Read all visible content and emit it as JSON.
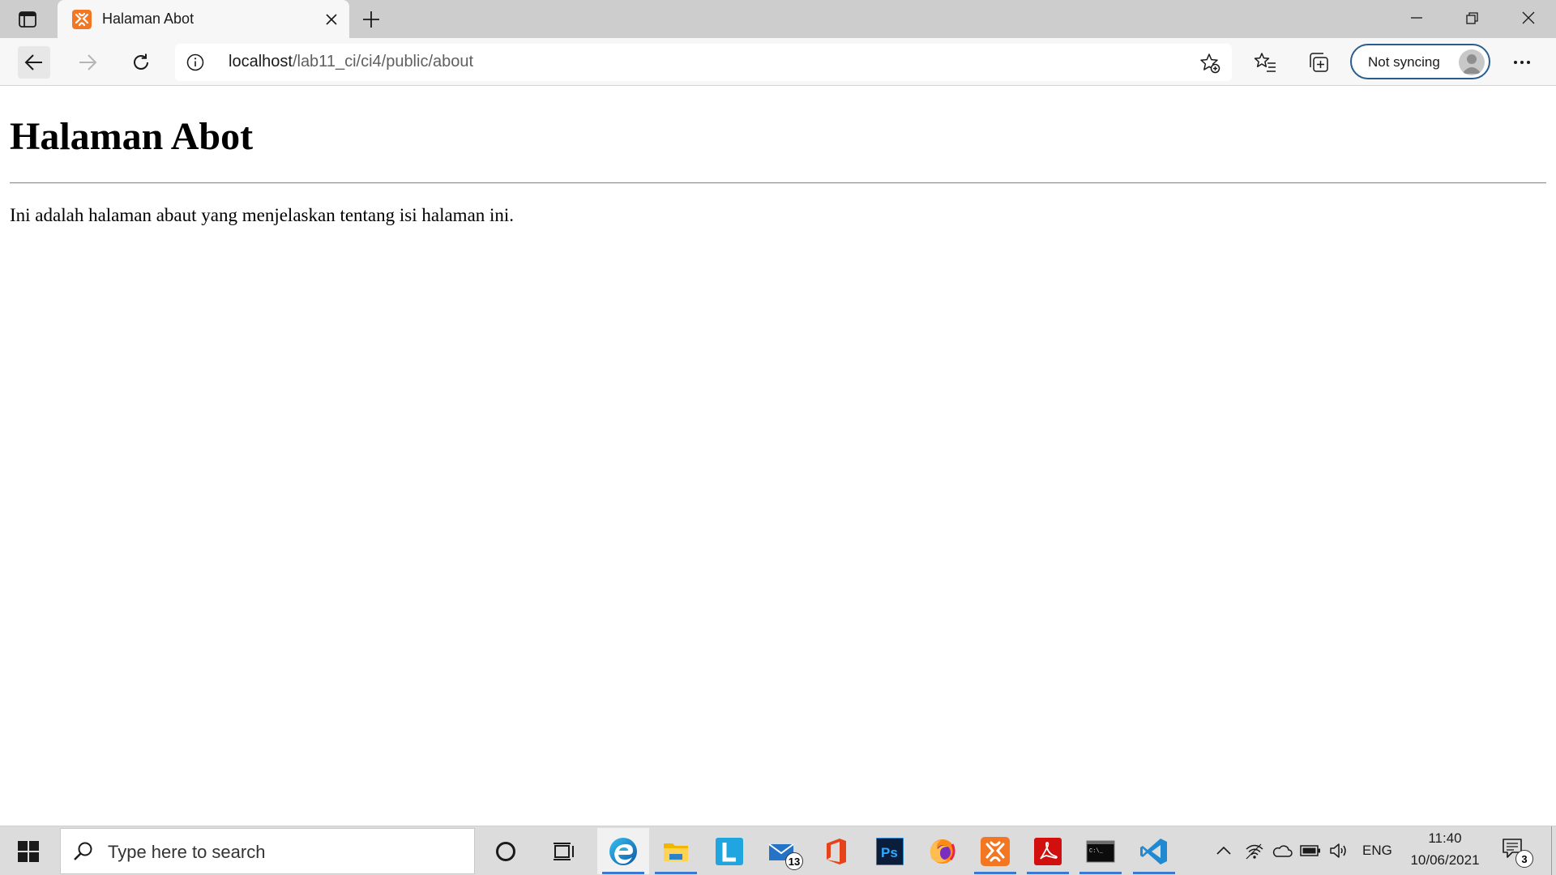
{
  "browser": {
    "tab": {
      "title": "Halaman Abot",
      "favicon": "xampp-icon"
    },
    "address": {
      "host": "localhost",
      "path": "/lab11_ci/ci4/public/about"
    },
    "sync": {
      "label": "Not syncing"
    }
  },
  "page": {
    "heading": "Halaman Abot",
    "paragraph": "Ini adalah halaman abaut yang menjelaskan tentang isi halaman ini."
  },
  "taskbar": {
    "search_placeholder": "Type here to search",
    "mail_badge": "13",
    "tray_language": "ENG",
    "clock_time": "11:40",
    "clock_date": "10/06/2021",
    "notification_count": "3",
    "apps": [
      "cortana",
      "task-view",
      "edge",
      "file-explorer",
      "l-app",
      "mail",
      "office",
      "photoshop",
      "firefox",
      "xampp",
      "acrobat",
      "terminal",
      "vscode"
    ]
  },
  "colors": {
    "tab_bar": "#cdcdcd",
    "toolbar": "#f7f7f7",
    "sync_border": "#2a5d8f",
    "taskbar": "#dcdcdc",
    "active_indicator": "#3b78d0",
    "xampp_orange": "#f37623"
  }
}
